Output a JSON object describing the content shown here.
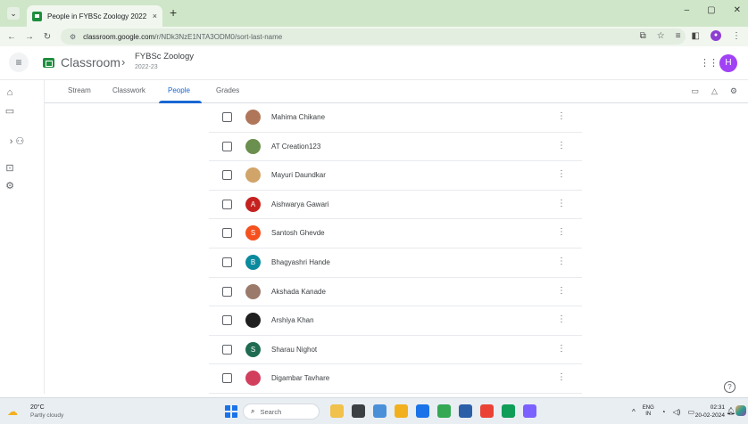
{
  "browser": {
    "tab_title": "People in FYBSc Zoology 2022",
    "tab_close": "×",
    "new_tab": "+",
    "url_domain": "classroom.google.com",
    "url_path": "/r/NDk3NzE1NTA3ODM0/sort-last-name",
    "nav": {
      "back": "←",
      "forward": "→",
      "reload": "↻"
    }
  },
  "header": {
    "app_name": "Classroom",
    "separator": "›",
    "class_name": "FYBSc Zoology",
    "class_year": "2022-23",
    "avatar_letter": "H"
  },
  "tabs": [
    {
      "label": "Stream",
      "active": false
    },
    {
      "label": "Classwork",
      "active": false
    },
    {
      "label": "People",
      "active": true
    },
    {
      "label": "Grades",
      "active": false
    }
  ],
  "people": [
    {
      "name": "Mahima Chikane",
      "initial": "",
      "color": "#b0765a"
    },
    {
      "name": "AT Creation123",
      "initial": "",
      "color": "#6b8f4e"
    },
    {
      "name": "Mayuri Daundkar",
      "initial": "",
      "color": "#d1a46a"
    },
    {
      "name": "Aishwarya Gawari",
      "initial": "A",
      "color": "#c5221f"
    },
    {
      "name": "Santosh Ghevde",
      "initial": "S",
      "color": "#f4511e"
    },
    {
      "name": "Bhagyashri Hande",
      "initial": "B",
      "color": "#0b8a9e"
    },
    {
      "name": "Akshada Kanade",
      "initial": "",
      "color": "#9c7a6b"
    },
    {
      "name": "Arshiya Khan",
      "initial": "",
      "color": "#1f1f1f"
    },
    {
      "name": "Sharau Nighot",
      "initial": "S",
      "color": "#1e6b52"
    },
    {
      "name": "Digambar Tavhare",
      "initial": "",
      "color": "#d23f5d"
    }
  ],
  "more_glyph": "⋮",
  "help_glyph": "?",
  "taskbar": {
    "temp": "20°C",
    "weather": "Partly cloudy",
    "search_placeholder": "Search",
    "lang_top": "ENG",
    "lang_bottom": "IN",
    "time": "02:31",
    "date": "20-02-2024",
    "app_colors": [
      "#f0c14b",
      "#3c4043",
      "#4a90d9",
      "#f2b01e",
      "#1a73e8",
      "#34a853",
      "#2b5fa8",
      "#ea4335",
      "#0f9d58",
      "#7b61ff"
    ]
  },
  "colors": {
    "accent": "#1967d2",
    "avatar": "#a142f4",
    "brand": "#1e8e3e"
  }
}
